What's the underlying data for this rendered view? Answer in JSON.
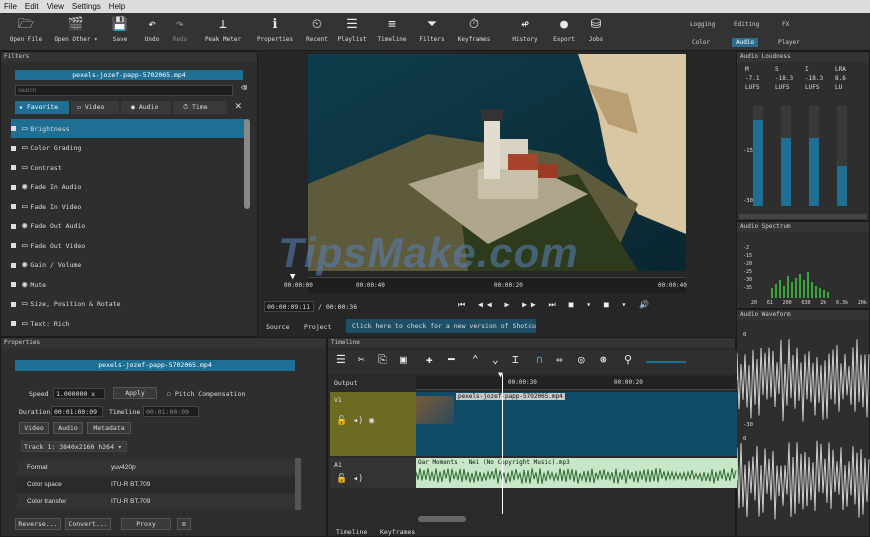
{
  "menu": [
    "File",
    "Edit",
    "View",
    "Settings",
    "Help"
  ],
  "toolbar": [
    {
      "icon": "folder-open-icon",
      "glyph": "🗁",
      "label": "Open File"
    },
    {
      "icon": "clapper-icon",
      "glyph": "🎬",
      "label": "Open Other ▾"
    },
    {
      "icon": "save-icon",
      "glyph": "💾",
      "label": "Save"
    },
    {
      "icon": "undo-icon",
      "glyph": "↶",
      "label": "Undo"
    },
    {
      "icon": "redo-icon",
      "glyph": "↷",
      "label": "Redo"
    },
    {
      "icon": "peak-meter-icon",
      "glyph": "⊥",
      "label": "Peak Meter"
    },
    {
      "icon": "properties-icon",
      "glyph": "ℹ",
      "label": "Properties"
    },
    {
      "icon": "recent-icon",
      "glyph": "⏲",
      "label": "Recent"
    },
    {
      "icon": "playlist-icon",
      "glyph": "☰",
      "label": "Playlist"
    },
    {
      "icon": "timeline-icon",
      "glyph": "≡",
      "label": "Timeline"
    },
    {
      "icon": "filters-icon",
      "glyph": "⏷",
      "label": "Filters"
    },
    {
      "icon": "keyframes-icon",
      "glyph": "⏱",
      "label": "Keyframes"
    },
    {
      "icon": "history-icon",
      "glyph": "↫",
      "label": "History"
    },
    {
      "icon": "export-icon",
      "glyph": "●",
      "label": "Export"
    },
    {
      "icon": "jobs-icon",
      "glyph": "⛁",
      "label": "Jobs"
    }
  ],
  "workspaces": {
    "logging": "Logging",
    "editing": "Editing",
    "fx": "FX",
    "color": "Color",
    "audio": "Audio",
    "player": "Player"
  },
  "filters": {
    "title": "Filters",
    "clip": "pexels-jozef-papp-5702065.mp4",
    "search_placeholder": "search",
    "tabs": [
      "Favorite",
      "Video",
      "Audio",
      "Time"
    ],
    "items": [
      {
        "label": "Brightness",
        "icon": "monitor-icon"
      },
      {
        "label": "Color Grading",
        "icon": "monitor-icon"
      },
      {
        "label": "Contrast",
        "icon": "monitor-icon"
      },
      {
        "label": "Fade In Audio",
        "icon": "speaker-icon"
      },
      {
        "label": "Fade In Video",
        "icon": "monitor-icon"
      },
      {
        "label": "Fade Out Audio",
        "icon": "speaker-icon"
      },
      {
        "label": "Fade Out Video",
        "icon": "monitor-icon"
      },
      {
        "label": "Gain / Volume",
        "icon": "speaker-icon"
      },
      {
        "label": "Mute",
        "icon": "speaker-icon"
      },
      {
        "label": "Size, Position & Rotate",
        "icon": "monitor-icon"
      },
      {
        "label": "Text: Rich",
        "icon": "monitor-icon"
      }
    ]
  },
  "player": {
    "ruler": [
      "00:00:00",
      "00:00:40",
      "00:00:20",
      "00:00:40"
    ],
    "current": "00:00:09:11",
    "total": "/ 00:00:36",
    "tabs": [
      "Source",
      "Project"
    ],
    "update_notice": "Click here to check for a new version of Shotcut.",
    "watermark": "TipsMake.com"
  },
  "properties": {
    "title": "Properties",
    "clip": "pexels-jozef-papp-5702065.mp4",
    "speed_label": "Speed",
    "speed_value": "1.000000 x",
    "apply": "Apply",
    "pitch": "Pitch Compensation",
    "duration_label": "Duration",
    "duration_value": "00:01:00:09",
    "timeline_label": "Timeline",
    "timeline_value": "00:01:00:09",
    "tabs": [
      "Video",
      "Audio",
      "Metadata"
    ],
    "track": "Track 1: 3840x2160 h264",
    "rows": [
      [
        "Format",
        "yuv420p"
      ],
      [
        "Color space",
        "ITU-R BT.709"
      ],
      [
        "Color transfer",
        "ITU-R BT.709"
      ]
    ],
    "buttons": [
      "Reverse...",
      "Convert...",
      "Proxy"
    ]
  },
  "audio": {
    "loudness_title": "Audio Loudness",
    "loudness_headers": [
      "M",
      "S",
      "I",
      "LRA"
    ],
    "loudness_values": [
      "-7.1",
      "-18.3",
      "-18.3",
      "8.6"
    ],
    "loudness_units": [
      "LUFS",
      "LUFS",
      "LUFS",
      "LU"
    ],
    "meter_ticks": [
      "0",
      "-15",
      "-30"
    ],
    "spectrum_title": "Audio Spectrum",
    "spectrum_ticks": [
      "-2",
      "-15",
      "-20",
      "-25",
      "-30",
      "-35"
    ],
    "spectrum_freqs": [
      "20",
      "61",
      "200",
      "630",
      "2k",
      "6.3k",
      "20k"
    ],
    "waveform_title": "Audio Waveform",
    "waveform_ticks": [
      "0",
      "-30",
      "0"
    ]
  },
  "timeline": {
    "title": "Timeline",
    "output": "Output",
    "tracks": [
      "V1",
      "A1"
    ],
    "ruler": [
      "00:00:30",
      "00:00:20"
    ],
    "video_clip": "pexels-jozef-papp-5702065.mp4",
    "audio_clip": "Oar Moments - Nei (No Copyright Music).mp3",
    "bottom_tabs": [
      "Timeline",
      "Keyframes"
    ]
  },
  "colors": {
    "accent": "#1f6f95",
    "video_track": "#6c6a23",
    "audio_clip": "#c8e6c8",
    "video_clip": "#0f4a66"
  }
}
